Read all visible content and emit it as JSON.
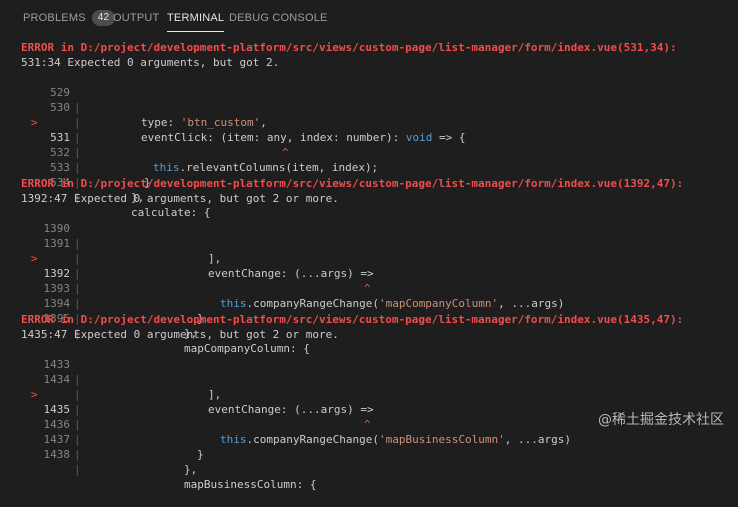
{
  "panel_tabs": [
    {
      "label": "PROBLEMS",
      "badge": "42"
    },
    {
      "label": "OUTPUT"
    },
    {
      "label": "TERMINAL"
    },
    {
      "label": "DEBUG CONSOLE"
    }
  ],
  "terminal": {
    "errors": [
      {
        "header": "ERROR in D:/project/development-platform/src/views/custom-page/list-manager/form/index.vue(531,34):",
        "message": "531:34 Expected 0 arguments, but got 2.",
        "lines": [
          {
            "num": "529",
            "code_a": "type: ",
            "code_b": "'btn_custom'",
            "code_c": ","
          },
          {
            "num": "530",
            "code_a": "eventClick: (item: any, index: number): ",
            "code_b": "void",
            "code_c": " => {"
          },
          {
            "num": "531",
            "marker": ">",
            "code_a": "this",
            "code_b": ".relevantColumns",
            "code_c": "(item, index);"
          },
          {
            "num": "",
            "caret": "^"
          },
          {
            "num": "532",
            "code_a": "}"
          },
          {
            "num": "533",
            "code_a": "},"
          },
          {
            "num": "534",
            "code_a": "calculate: {"
          }
        ]
      },
      {
        "header": "ERROR in D:/project/development-platform/src/views/custom-page/list-manager/form/index.vue(1392,47):",
        "message": "1392:47 Expected 0 arguments, but got 2 or more.",
        "lines": [
          {
            "num": "1390",
            "code_a": "],"
          },
          {
            "num": "1391",
            "code_a": "eventChange: (...args) =>"
          },
          {
            "num": "1392",
            "marker": ">",
            "code_a": "this",
            "code_b": ".companyRangeChange(",
            "code_c": "'mapCompanyColumn'",
            "code_d": ", ...args)"
          },
          {
            "num": "",
            "caret": "^"
          },
          {
            "num": "1393",
            "code_a": "}"
          },
          {
            "num": "1394",
            "code_a": "},"
          },
          {
            "num": "1395",
            "code_a": "mapCompanyColumn: {"
          }
        ]
      },
      {
        "header": "ERROR in D:/project/development-platform/src/views/custom-page/list-manager/form/index.vue(1435,47):",
        "message": "1435:47 Expected 0 arguments, but got 2 or more.",
        "lines": [
          {
            "num": "1433",
            "code_a": "],"
          },
          {
            "num": "1434",
            "code_a": "eventChange: (...args) =>"
          },
          {
            "num": "1435",
            "marker": ">",
            "code_a": "this",
            "code_b": ".companyRangeChange(",
            "code_c": "'mapBusinessColumn'",
            "code_d": ", ...args)"
          },
          {
            "num": "",
            "caret": "^"
          },
          {
            "num": "1436",
            "code_a": "}"
          },
          {
            "num": "1437",
            "code_a": "},"
          },
          {
            "num": "1438",
            "code_a": "mapBusinessColumn: {"
          }
        ]
      }
    ]
  },
  "watermark": "@稀土掘金技术社区",
  "colors": {
    "error": "#f14c4c",
    "string": "#ce9178",
    "keyword": "#569cd6",
    "background": "#1e1e1e"
  }
}
